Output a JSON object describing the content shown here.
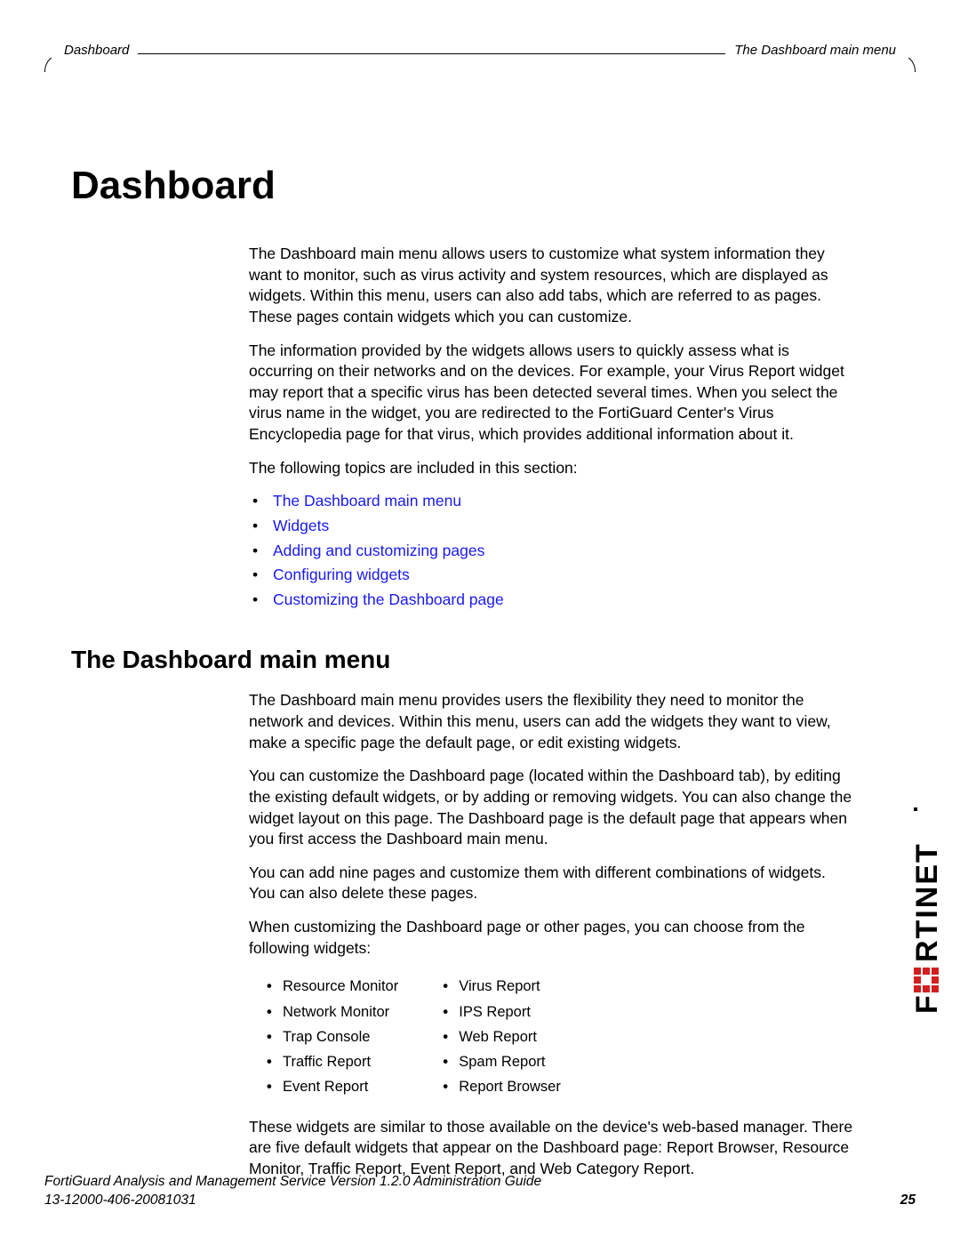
{
  "header": {
    "left": "Dashboard",
    "right": "The Dashboard main menu"
  },
  "chapter_title": "Dashboard",
  "intro": {
    "p1": "The Dashboard main menu allows users to customize what system information they want to monitor, such as virus activity and system resources, which are displayed as widgets. Within this menu, users can also add tabs, which are referred to as pages. These pages contain widgets which you can customize.",
    "p2": "The information provided by the widgets allows users to quickly assess what is occurring on their networks and on the devices. For example, your Virus Report widget may report that a specific virus has been detected several times. When you select the virus name in the widget, you are redirected to the FortiGuard Center's Virus Encyclopedia page for that virus, which provides additional information about it.",
    "p3": "The following topics are included in this section:"
  },
  "topics": [
    "The Dashboard main menu",
    "Widgets",
    "Adding and customizing pages",
    "Configuring widgets",
    "Customizing the Dashboard page"
  ],
  "section_title": "The Dashboard main menu",
  "section": {
    "p1": "The Dashboard main menu provides users the flexibility they need to monitor the network and devices. Within this menu, users can add the widgets they want to view, make a specific page the default page, or edit existing widgets.",
    "p2": "You can customize the Dashboard page (located within the Dashboard tab), by editing the existing default widgets, or by adding or removing widgets. You can also change the widget layout on this page. The Dashboard page is the default page that appears when you first access the Dashboard main menu.",
    "p3": "You can add nine pages and customize them with different combinations of widgets. You can also delete these pages.",
    "p4": "When customizing the Dashboard page or other pages, you can choose from the following widgets:"
  },
  "widgets_col1": [
    "Resource Monitor",
    "Network Monitor",
    "Trap Console",
    "Traffic Report",
    "Event Report"
  ],
  "widgets_col2": [
    "Virus Report",
    "IPS Report",
    "Web Report",
    "Spam Report",
    "Report Browser"
  ],
  "section_tail": "These widgets are similar to those available on the device's web-based manager. There are five default widgets that appear on the Dashboard page: Report Browser, Resource Monitor, Traffic Report, Event Report, and Web Category Report.",
  "footer": {
    "line1": "FortiGuard Analysis and Management Service Version 1.2.0 Administration Guide",
    "line2": "13-12000-406-20081031",
    "page": "25"
  },
  "brand": "F RTINET"
}
